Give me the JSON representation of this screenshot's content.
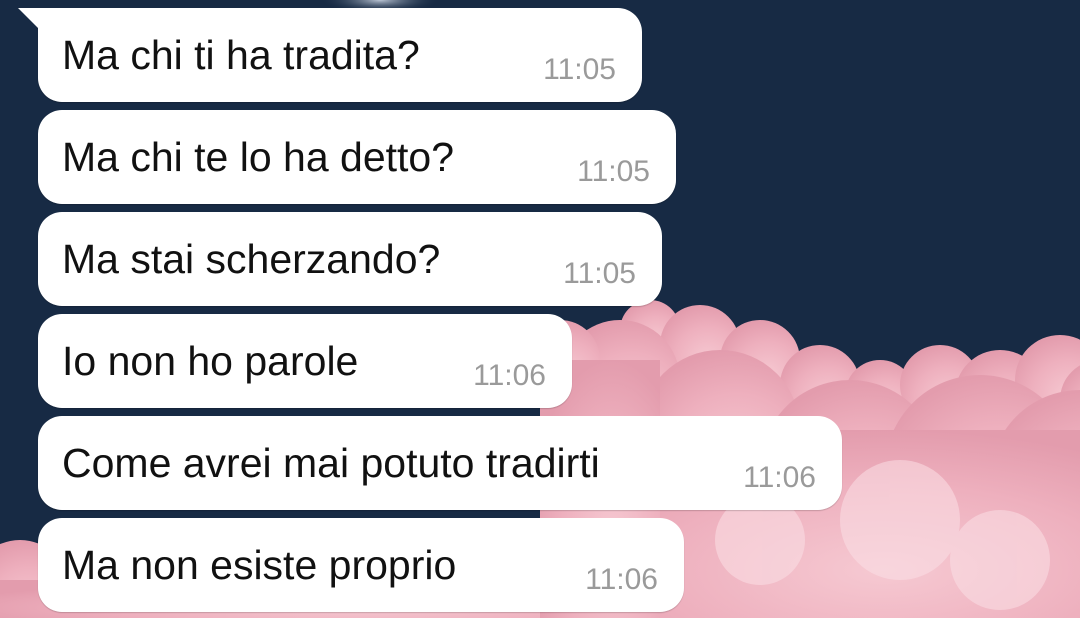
{
  "theme": {
    "sky_color": "#172a44",
    "cloud_color": "#f2b8c4",
    "bubble_color": "#ffffff",
    "text_color": "#111111",
    "time_color": "#9a9a9a"
  },
  "messages": [
    {
      "text": "Ma chi ti ha tradita?",
      "time": "11:05"
    },
    {
      "text": "Ma chi te lo ha detto?",
      "time": "11:05"
    },
    {
      "text": "Ma stai scherzando?",
      "time": "11:05"
    },
    {
      "text": "Io non ho parole",
      "time": "11:06"
    },
    {
      "text": "Come avrei mai potuto tradirti",
      "time": "11:06"
    },
    {
      "text": "Ma non esiste proprio",
      "time": "11:06"
    }
  ]
}
